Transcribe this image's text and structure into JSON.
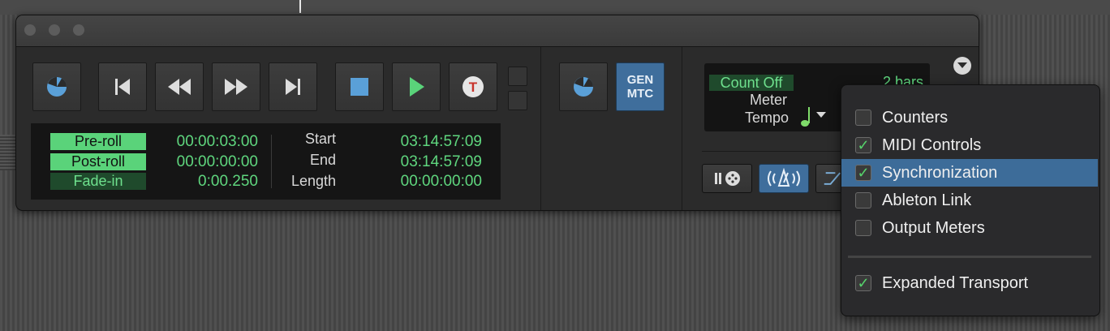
{
  "transport": {
    "info": {
      "preroll_label": "Pre-roll",
      "postroll_label": "Post-roll",
      "fadein_label": "Fade-in",
      "preroll_value": "00:00:03:00",
      "postroll_value": "00:00:00:00",
      "fadein_value": "0:00.250",
      "start_label": "Start",
      "end_label": "End",
      "length_label": "Length",
      "start_value": "03:14:57:09",
      "end_value": "03:14:57:09",
      "length_value": "00:00:00:00"
    },
    "gen_mtc_line1": "GEN",
    "gen_mtc_line2": "MTC",
    "counter": {
      "count_off_label": "Count Off",
      "bars_value": "2 bars",
      "meter_label": "Meter",
      "tempo_label": "Tempo"
    }
  },
  "menu": {
    "items": [
      {
        "label": "Counters",
        "checked": false,
        "selected": false
      },
      {
        "label": "MIDI Controls",
        "checked": true,
        "selected": false
      },
      {
        "label": "Synchronization",
        "checked": true,
        "selected": true
      },
      {
        "label": "Ableton Link",
        "checked": false,
        "selected": false
      },
      {
        "label": "Output Meters",
        "checked": false,
        "selected": false
      },
      {
        "label": "Expanded Transport",
        "checked": true,
        "selected": false
      }
    ],
    "check_glyph": "✓"
  },
  "colors": {
    "accent_blue": "#3f6e9c",
    "green_text": "#5fd67e",
    "green_tag": "#5ad37a",
    "selected_row": "#3d6c99",
    "record_red": "#c8332b"
  },
  "icons": [
    "online-icon",
    "return-to-zero-icon",
    "rewind-icon",
    "fast-forward-icon",
    "go-to-end-icon",
    "stop-icon",
    "play-icon",
    "record-icon",
    "midi-merge-icon",
    "metronome-icon",
    "quarter-note-icon",
    "dropdown-arrow-icon"
  ]
}
